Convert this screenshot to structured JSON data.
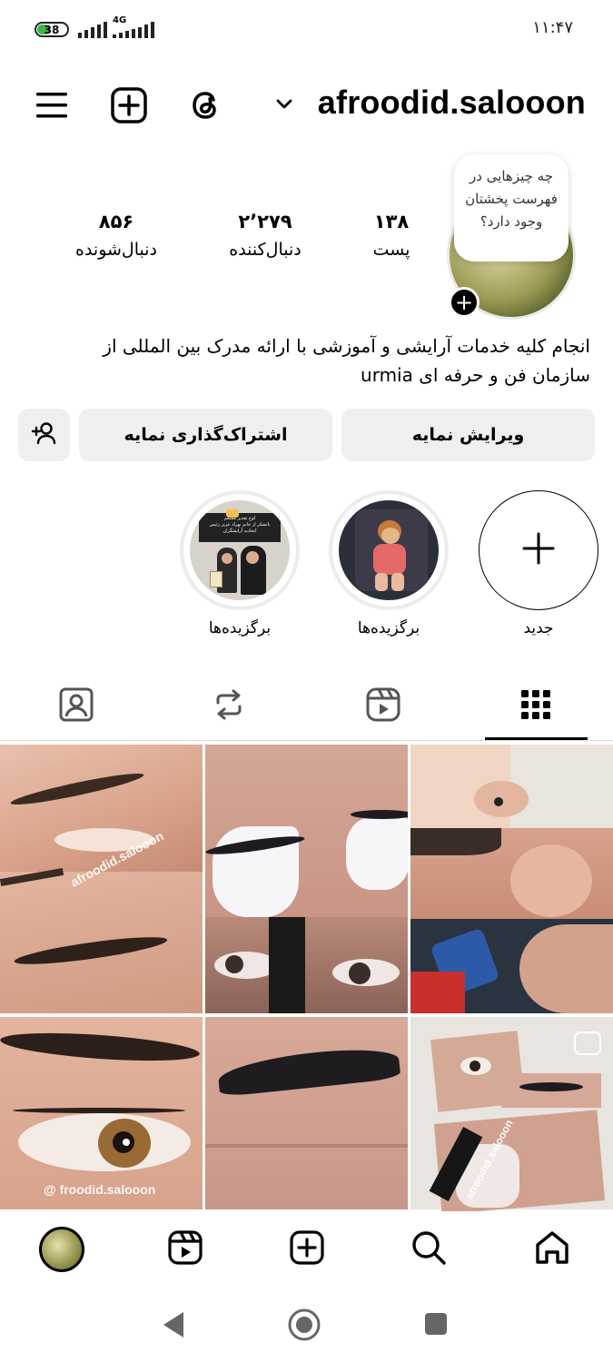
{
  "status_bar": {
    "battery": "38",
    "network": "4G",
    "time": "۱۱:۴۷"
  },
  "header": {
    "username": "afroodid.salooon"
  },
  "profile": {
    "note": "چه چیزهایی در فهرست پخشتان وجود دارد؟",
    "stats": {
      "posts_value": "۱۳۸",
      "posts_label": "پست",
      "following_value": "۲٬۲۷۹",
      "following_label": "دنبال‌کننده",
      "followers_value": "۸۵۶",
      "followers_label": "دنبال‌شونده"
    },
    "bio": "انجام کلیه خدمات آرایشی و آموزشی با ارائه مدرک بین المللی از سازمان فن و حرفه ای urmia"
  },
  "actions": {
    "edit_profile": "ویرایش نمایه",
    "share_profile": "اشتراک‌گذاری نمایه"
  },
  "highlights": [
    {
      "label": "جدید"
    },
    {
      "label": "برگزیده‌ها"
    },
    {
      "label": "برگزیده‌ها",
      "caption_line1": "لوح تقدیر مسمم",
      "caption_line2": "باتشکر از خانم نهراد عزیز رئیس",
      "caption_line3": "اتحادیه آرایشگران"
    }
  ],
  "posts": [
    {
      "watermark": "afroodid.salooon"
    },
    {
      "watermark": ""
    },
    {
      "watermark": ""
    },
    {
      "watermark": "@ froodid.salooon"
    },
    {
      "watermark": ""
    },
    {
      "watermark": "afroodid.salooon"
    }
  ],
  "colors": {
    "button_bg": "#efefef",
    "active_tab": "#000000",
    "battery": "#3bb54a"
  },
  "icons": [
    "menu-icon",
    "add-post-icon",
    "threads-icon",
    "chevron-down-icon",
    "add-person-icon",
    "plus-icon",
    "grid-icon",
    "reels-icon",
    "reposts-icon",
    "tagged-icon",
    "home-icon",
    "search-icon",
    "create-icon",
    "reels-nav-icon"
  ]
}
